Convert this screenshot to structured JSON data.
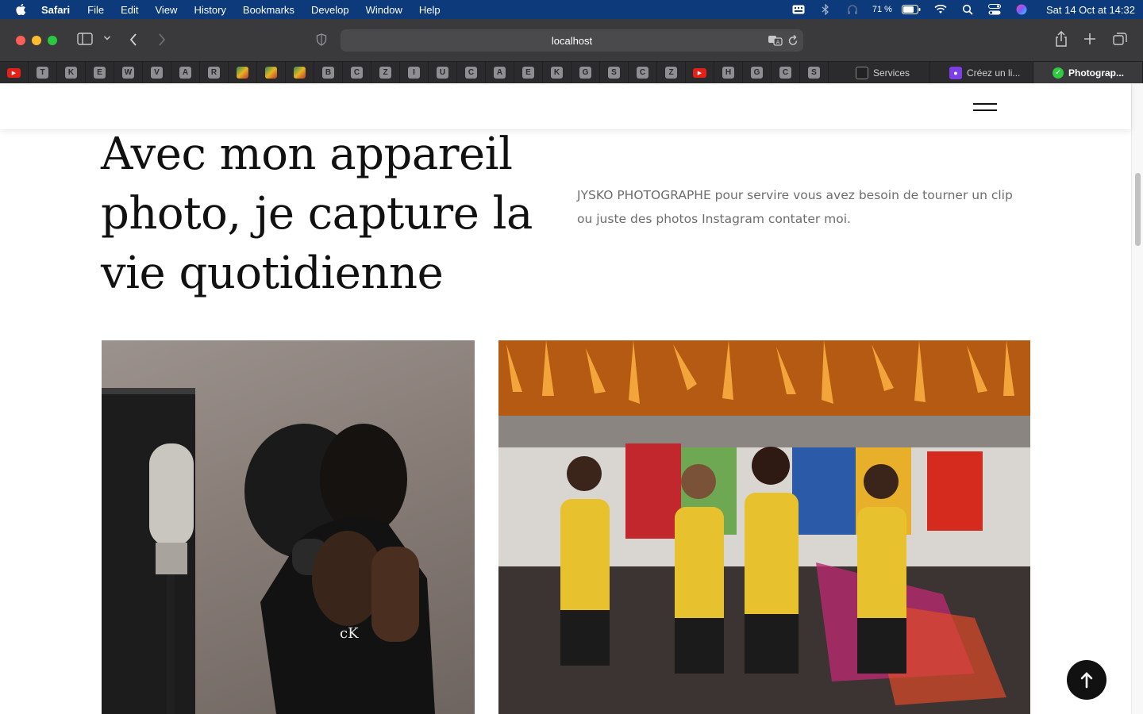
{
  "menubar": {
    "app_name": "Safari",
    "items": [
      "File",
      "Edit",
      "View",
      "History",
      "Bookmarks",
      "Develop",
      "Window",
      "Help"
    ],
    "battery_percent": "71 %",
    "datetime": "Sat 14 Oct at 14:32"
  },
  "toolbar": {
    "address": "localhost"
  },
  "tabs": {
    "pinned": [
      "YT",
      "T",
      "K",
      "E",
      "W",
      "V",
      "A",
      "R",
      "",
      "",
      "",
      "B",
      "C",
      "Z",
      "I",
      "U",
      "C",
      "A",
      "E",
      "K",
      "G",
      "S",
      "C",
      "Z",
      "YT",
      "H",
      "G",
      "C",
      "S"
    ],
    "open": [
      {
        "title": "Services",
        "fav_color": "#222222"
      },
      {
        "title": "Créez un li...",
        "fav_color": "#7b3fe4"
      },
      {
        "title": "Photograp...",
        "fav_color": "#2ecc40"
      }
    ]
  },
  "hero": {
    "title": "Avec mon appareil photo, je capture la vie quotidienne",
    "description": "JYSKO PHOTOGRAPHE pour servire vous avez besoin de tourner un clip ou juste des photos Instagram contater moi."
  },
  "colors": {
    "menubar_bg": "#0c3a7a",
    "toolbar_bg": "#3a3a3c",
    "title_color": "#111111",
    "body_text": "#6d6d6d",
    "accent_button": "#111111"
  }
}
